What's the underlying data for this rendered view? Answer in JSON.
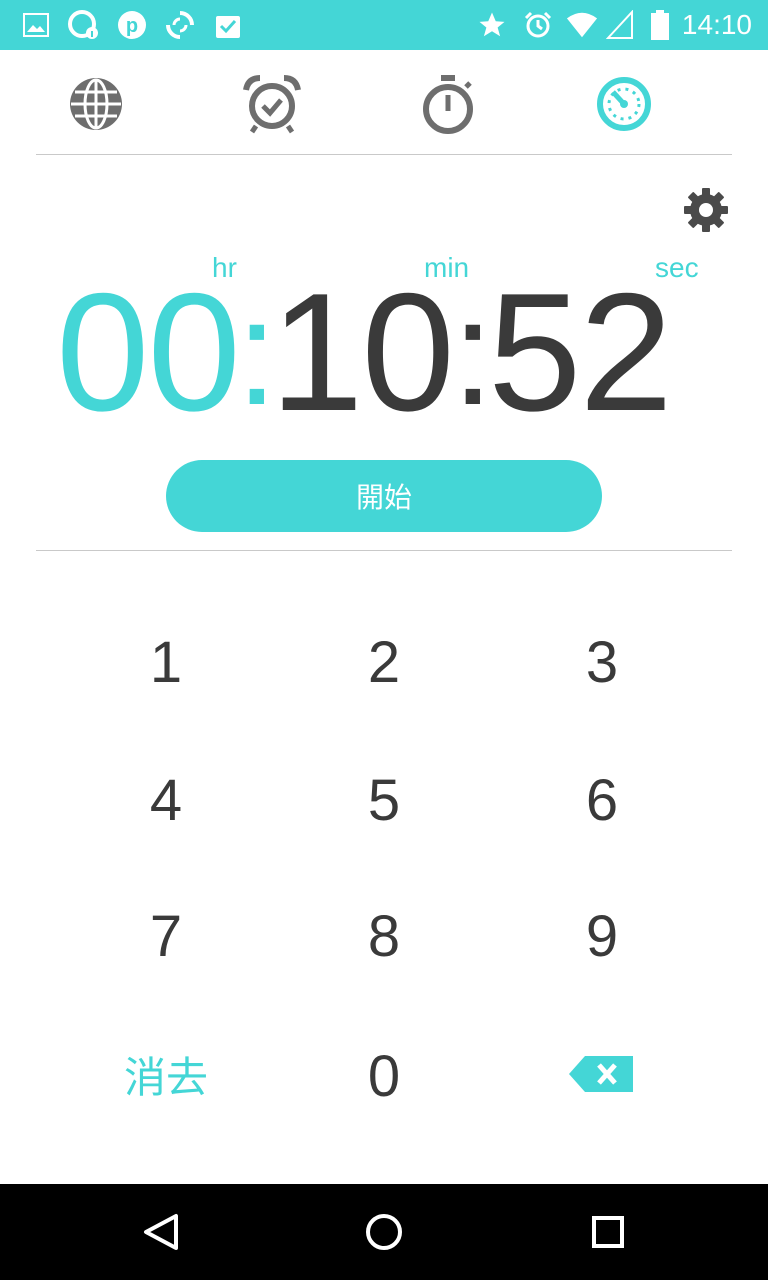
{
  "status_bar": {
    "time": "14:10",
    "left_icons": [
      "gallery-icon",
      "info-app-icon",
      "pinterest-icon",
      "sync-app-icon",
      "clipboard-check-icon"
    ],
    "right_icons": [
      "star-icon",
      "alarm-icon",
      "wifi-icon",
      "signal-icon",
      "battery-icon"
    ]
  },
  "tabs": [
    {
      "name": "world-clock",
      "icon": "globe-icon"
    },
    {
      "name": "alarm",
      "icon": "alarm-clock-icon"
    },
    {
      "name": "stopwatch",
      "icon": "stopwatch-icon"
    },
    {
      "name": "timer",
      "icon": "timer-icon",
      "active": true
    }
  ],
  "timer": {
    "unit_hr": "hr",
    "unit_min": "min",
    "unit_sec": "sec",
    "hours": "00",
    "minutes": "10",
    "seconds": "52",
    "separator": ":"
  },
  "start_button": "開始",
  "keypad": {
    "k1": "1",
    "k2": "2",
    "k3": "3",
    "k4": "4",
    "k5": "5",
    "k6": "6",
    "k7": "7",
    "k8": "8",
    "k9": "9",
    "clear": "消去",
    "k0": "0"
  },
  "colors": {
    "accent": "#44d6d6",
    "text": "#3a3a3a"
  }
}
